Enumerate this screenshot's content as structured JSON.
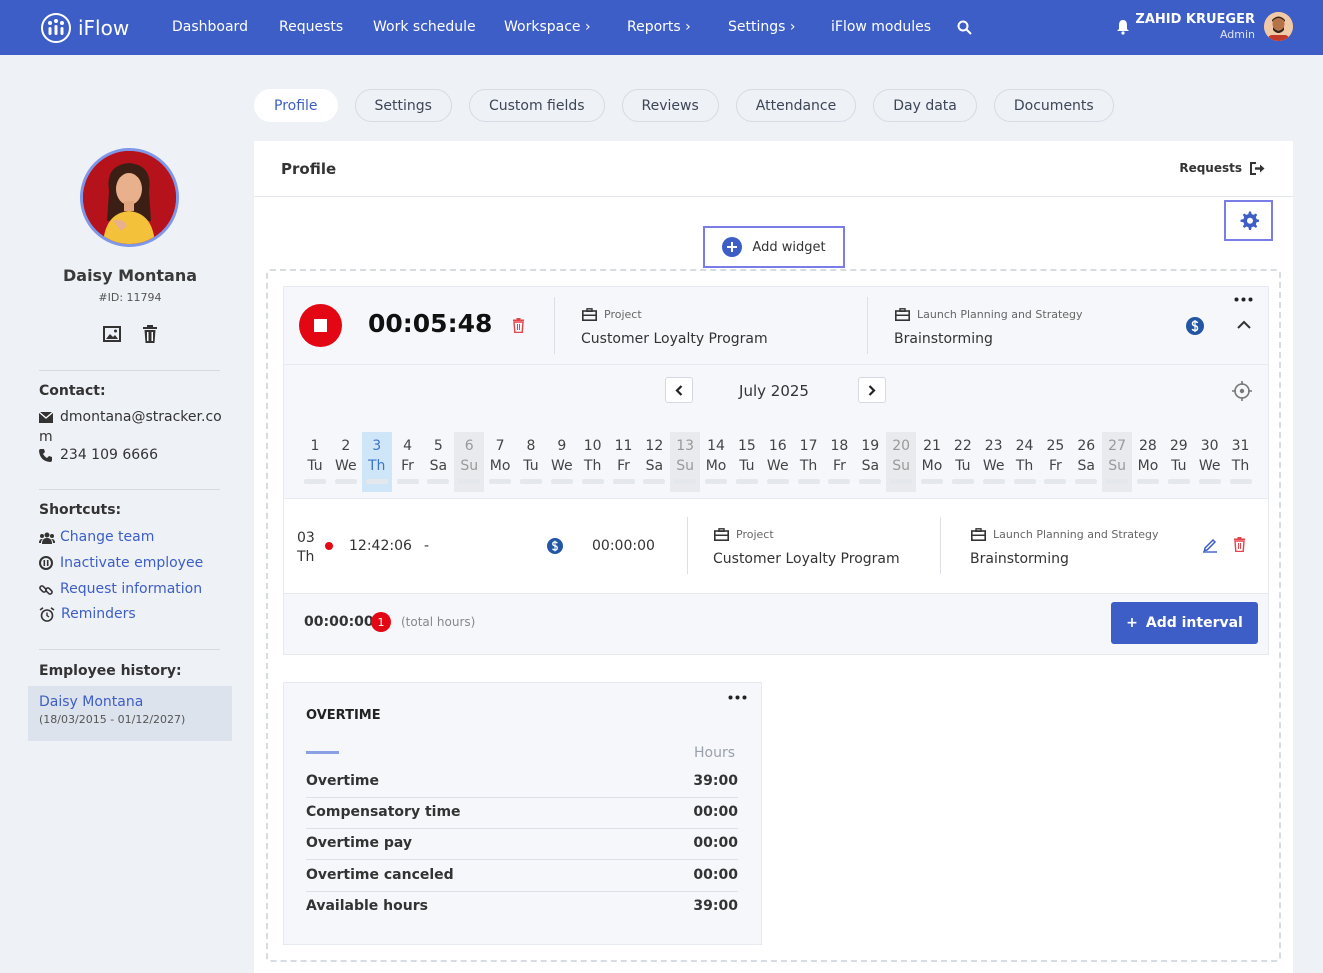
{
  "app": {
    "brand": "iFlow"
  },
  "nav": {
    "items": [
      {
        "label": "Dashboard"
      },
      {
        "label": "Requests"
      },
      {
        "label": "Work schedule"
      },
      {
        "label": "Workspace",
        "chevron": true
      },
      {
        "label": "Reports",
        "chevron": true
      },
      {
        "label": "Settings",
        "chevron": true
      },
      {
        "label": "iFlow modules"
      }
    ],
    "user_name": "ZAHID KRUEGER",
    "user_role": "Admin"
  },
  "tabs": [
    "Profile",
    "Settings",
    "Custom fields",
    "Reviews",
    "Attendance",
    "Day data",
    "Documents"
  ],
  "active_tab": "Profile",
  "employee": {
    "name": "Daisy Montana",
    "id_label": "#ID: 11794",
    "contact_title": "Contact:",
    "email_line1": "dmontana@stracker.co",
    "email_line2": "m",
    "phone": "234 109 6666",
    "shortcuts_title": "Shortcuts:",
    "shortcuts": [
      "Change team",
      "Inactivate employee",
      "Request information",
      "Reminders"
    ],
    "history_title": "Employee history:",
    "history_name": "Daisy Montana",
    "history_dates": "(18/03/2015 - 01/12/2027)"
  },
  "profile": {
    "title": "Profile",
    "requests_link": "Requests",
    "add_widget": "Add widget"
  },
  "timer": {
    "elapsed": "00:05:48",
    "project_label": "Project",
    "project_value": "Customer Loyalty Program",
    "task_label": "Launch Planning and Strategy",
    "task_value": "Brainstorming"
  },
  "calendar": {
    "month": "July 2025",
    "days": [
      {
        "n": "1",
        "d": "Tu"
      },
      {
        "n": "2",
        "d": "We"
      },
      {
        "n": "3",
        "d": "Th",
        "today": true
      },
      {
        "n": "4",
        "d": "Fr"
      },
      {
        "n": "5",
        "d": "Sa"
      },
      {
        "n": "6",
        "d": "Su",
        "weekend": true
      },
      {
        "n": "7",
        "d": "Mo"
      },
      {
        "n": "8",
        "d": "Tu"
      },
      {
        "n": "9",
        "d": "We"
      },
      {
        "n": "10",
        "d": "Th"
      },
      {
        "n": "11",
        "d": "Fr"
      },
      {
        "n": "12",
        "d": "Sa"
      },
      {
        "n": "13",
        "d": "Su",
        "weekend": true
      },
      {
        "n": "14",
        "d": "Mo"
      },
      {
        "n": "15",
        "d": "Tu"
      },
      {
        "n": "16",
        "d": "We"
      },
      {
        "n": "17",
        "d": "Th"
      },
      {
        "n": "18",
        "d": "Fr"
      },
      {
        "n": "19",
        "d": "Sa"
      },
      {
        "n": "20",
        "d": "Su",
        "weekend": true
      },
      {
        "n": "21",
        "d": "Mo"
      },
      {
        "n": "22",
        "d": "Tu"
      },
      {
        "n": "23",
        "d": "We"
      },
      {
        "n": "24",
        "d": "Th"
      },
      {
        "n": "25",
        "d": "Fr"
      },
      {
        "n": "26",
        "d": "Sa"
      },
      {
        "n": "27",
        "d": "Su",
        "weekend": true
      },
      {
        "n": "28",
        "d": "Mo"
      },
      {
        "n": "29",
        "d": "Tu"
      },
      {
        "n": "30",
        "d": "We"
      },
      {
        "n": "31",
        "d": "Th"
      }
    ]
  },
  "interval": {
    "day_num": "03",
    "day_name": "Th",
    "start": "12:42:06",
    "dash": "-",
    "duration": "00:00:00",
    "project_label": "Project",
    "project_value": "Customer Loyalty Program",
    "task_label": "Launch Planning and Strategy",
    "task_value": "Brainstorming"
  },
  "totals": {
    "hours": "00:00:00",
    "count": "1",
    "label": "(total hours)",
    "add_interval": "Add interval"
  },
  "overtime": {
    "title": "OVERTIME",
    "col_header": "Hours",
    "rows": [
      {
        "label": "Overtime",
        "value": "39:00"
      },
      {
        "label": "Compensatory time",
        "value": "00:00"
      },
      {
        "label": "Overtime pay",
        "value": "00:00"
      },
      {
        "label": "Overtime canceled",
        "value": "00:00"
      },
      {
        "label": "Available hours",
        "value": "39:00"
      }
    ]
  },
  "colors": {
    "primary": "#3d5ec6",
    "danger": "#e30613",
    "highlight_border": "#7a7de8"
  }
}
